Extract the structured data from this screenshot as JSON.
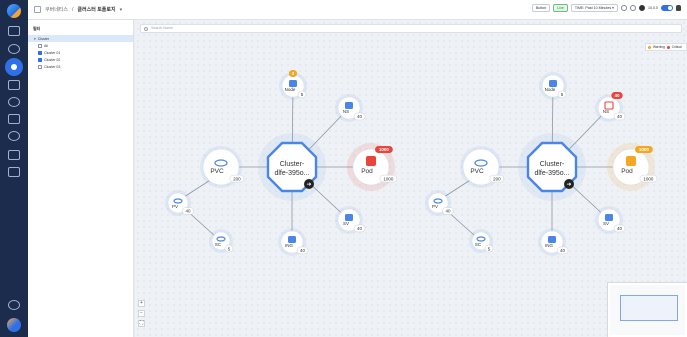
{
  "breadcrumb": {
    "parent": "쿠버네티스",
    "separator": "/",
    "current": "클러스터 토폴로지"
  },
  "toolbar": {
    "button_label": "Button",
    "live_label": "Live",
    "time_range": "TIME: Past 10 Minutes",
    "interval": "10.0.0"
  },
  "search": {
    "placeholder": "Search Name"
  },
  "filter_panel": {
    "title": "필터",
    "tree": [
      {
        "label": "Cluster",
        "checked": null,
        "selected": true,
        "child": false
      },
      {
        "label": "All",
        "checked": false,
        "selected": false,
        "child": true
      },
      {
        "label": "Cluster 01",
        "checked": true,
        "selected": false,
        "child": true
      },
      {
        "label": "Cluster 02",
        "checked": true,
        "selected": false,
        "child": true
      },
      {
        "label": "Cluster 03",
        "checked": false,
        "selected": false,
        "child": true
      }
    ]
  },
  "legend": {
    "warning": "Warning",
    "critical": "Critical"
  },
  "colors": {
    "accent": "#2f6fe8",
    "warning": "#f5a623",
    "critical": "#e8453c",
    "rail": "#1c2c4c"
  },
  "clusters": [
    {
      "name_line1": "Cluster-",
      "name_line2": "dlfe-395o...",
      "nodes": [
        {
          "type": "node",
          "label": "Node",
          "count": "5",
          "badge": "3",
          "badge_color": "#f5a623",
          "icon": "node-icon"
        },
        {
          "type": "ns",
          "label": "NS",
          "count": "40",
          "badge": "",
          "badge_color": "",
          "icon": "namespace-icon"
        },
        {
          "type": "pod",
          "label": "Pod",
          "count": "1000",
          "badge": "1000",
          "badge_color": "#e8453c",
          "icon": "pod-icon"
        },
        {
          "type": "sv",
          "label": "SV",
          "count": "40",
          "badge": "",
          "badge_color": "",
          "icon": "service-icon"
        },
        {
          "type": "ing",
          "label": "ING",
          "count": "40",
          "badge": "",
          "badge_color": "",
          "icon": "ingress-icon"
        },
        {
          "type": "pvc",
          "label": "PVC",
          "count": "200",
          "badge": "",
          "badge_color": "",
          "icon": "pvc-icon"
        },
        {
          "type": "pv",
          "label": "PV",
          "count": "40",
          "badge": "",
          "badge_color": "",
          "icon": "pv-icon"
        },
        {
          "type": "sc",
          "label": "SC",
          "count": "5",
          "badge": "",
          "badge_color": "",
          "icon": "storageclass-icon"
        }
      ]
    },
    {
      "name_line1": "Cluster-",
      "name_line2": "dlfe-395o...",
      "nodes": [
        {
          "type": "node",
          "label": "Node",
          "count": "5",
          "badge": "",
          "badge_color": "",
          "icon": "node-icon"
        },
        {
          "type": "ns",
          "label": "NS",
          "count": "40",
          "badge": "40",
          "badge_color": "#e8453c",
          "icon": "namespace-icon"
        },
        {
          "type": "pod",
          "label": "Pod",
          "count": "1000",
          "badge": "1000",
          "badge_color": "#f5a623",
          "icon": "pod-icon"
        },
        {
          "type": "sv",
          "label": "SV",
          "count": "40",
          "badge": "",
          "badge_color": "",
          "icon": "service-icon"
        },
        {
          "type": "ing",
          "label": "ING",
          "count": "40",
          "badge": "",
          "badge_color": "",
          "icon": "ingress-icon"
        },
        {
          "type": "pvc",
          "label": "PVC",
          "count": "200",
          "badge": "",
          "badge_color": "",
          "icon": "pvc-icon"
        },
        {
          "type": "pv",
          "label": "PV",
          "count": "40",
          "badge": "",
          "badge_color": "",
          "icon": "pv-icon"
        },
        {
          "type": "sc",
          "label": "SC",
          "count": "5",
          "badge": "",
          "badge_color": "",
          "icon": "storageclass-icon"
        }
      ]
    }
  ]
}
